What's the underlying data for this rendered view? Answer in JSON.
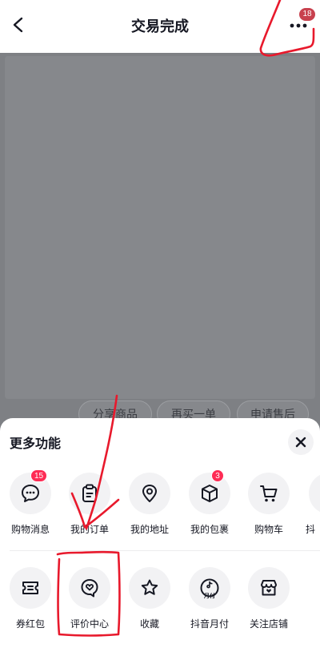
{
  "header": {
    "title": "交易完成",
    "message_badge": "18"
  },
  "background_actions": [
    "分享商品",
    "再买一单",
    "申请售后"
  ],
  "sheet": {
    "title": "更多功能",
    "row1": [
      {
        "label": "购物消息",
        "icon": "chat-bubble-icon",
        "badge": "15"
      },
      {
        "label": "我的订单",
        "icon": "order-clipboard-icon",
        "badge": ""
      },
      {
        "label": "我的地址",
        "icon": "location-pin-icon",
        "badge": ""
      },
      {
        "label": "我的包裹",
        "icon": "package-box-icon",
        "badge": "3"
      },
      {
        "label": "购物车",
        "icon": "shopping-cart-icon",
        "badge": ""
      },
      {
        "label": "抖",
        "icon": "partial-icon",
        "badge": ""
      }
    ],
    "row2": [
      {
        "label": "券红包",
        "icon": "coupon-icon"
      },
      {
        "label": "评价中心",
        "icon": "review-heart-icon"
      },
      {
        "label": "收藏",
        "icon": "star-icon"
      },
      {
        "label": "抖音月付",
        "icon": "monthly-pay-icon",
        "icon_text": "月付"
      },
      {
        "label": "关注店铺",
        "icon": "store-follow-icon"
      }
    ]
  },
  "colors": {
    "accent": "#fe2c55",
    "annotation": "#e8192c",
    "overlay": "#7e8084"
  }
}
